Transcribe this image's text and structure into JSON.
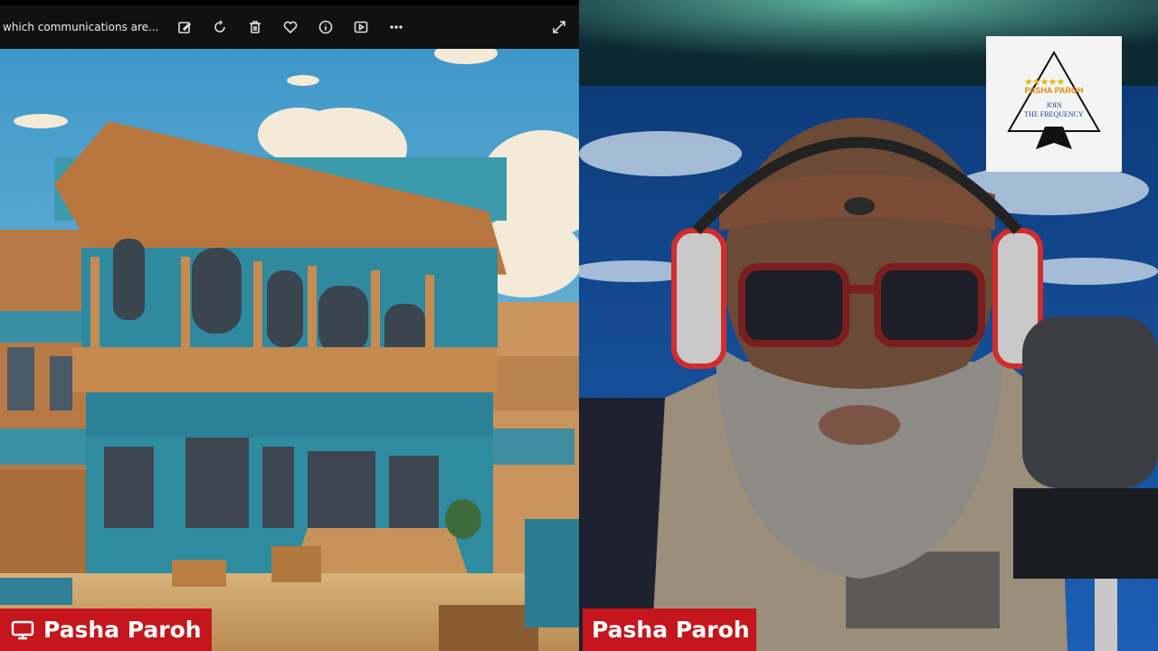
{
  "viewer": {
    "caption": "which communications are...",
    "tools": [
      {
        "name": "edit-image-icon"
      },
      {
        "name": "rotate-icon"
      },
      {
        "name": "delete-icon"
      },
      {
        "name": "favorite-icon"
      },
      {
        "name": "info-icon"
      },
      {
        "name": "slideshow-icon"
      },
      {
        "name": "more-icon"
      }
    ],
    "expand_icon": "expand-icon"
  },
  "left_tag": {
    "label": "Pasha Paroh",
    "icon": "screen-share-icon"
  },
  "right_tag": {
    "label": "Pasha Paroh"
  },
  "logo": {
    "stars": "★★★★★",
    "brand": "PASHA PAROH",
    "line1": "JOIN",
    "line2": "THE FREQUENCY"
  },
  "colors": {
    "tag_red": "#c4161c",
    "toolbar": "#111111"
  }
}
